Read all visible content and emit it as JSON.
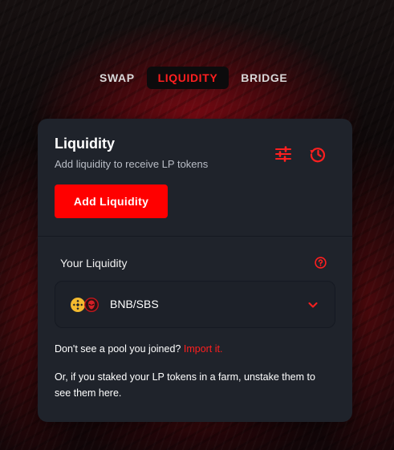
{
  "tabs": [
    {
      "label": "SWAP",
      "active": false
    },
    {
      "label": "LIQUIDITY",
      "active": true
    },
    {
      "label": "BRIDGE",
      "active": false
    }
  ],
  "card": {
    "title": "Liquidity",
    "subtitle": "Add liquidity to receive LP tokens",
    "add_button_label": "Add Liquidity",
    "your_liquidity_label": "Your Liquidity",
    "pool": {
      "pair": "BNB/SBS",
      "token_icons": [
        "bnb-token-icon",
        "sbs-token-icon"
      ]
    },
    "import_prompt": "Don't see a pool you joined?",
    "import_link": "Import it.",
    "unstake_hint": "Or, if you staked your LP tokens in a farm, unstake them to see them here."
  },
  "icons": {
    "settings": "settings-sliders-icon",
    "history": "history-icon",
    "help": "question-icon",
    "expand": "chevron-down-icon"
  },
  "colors": {
    "accent": "#ff0000",
    "card_bg": "#1f232b",
    "text_muted": "#b9bdc6"
  }
}
